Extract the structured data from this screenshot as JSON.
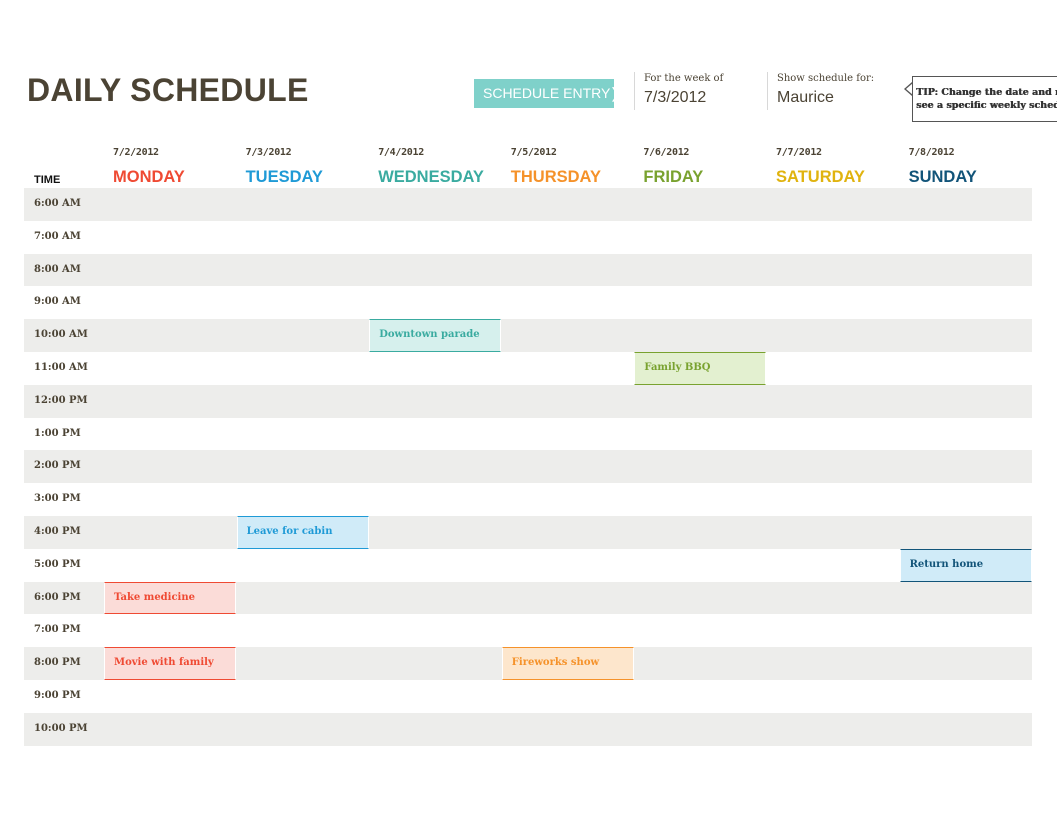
{
  "header": {
    "title": "DAILY SCHEDULE",
    "schedule_entry_button": "SCHEDULE ENTRY",
    "schedule_entry_arrow": "❯",
    "week_label": "For the week of",
    "week_value": "7/3/2012",
    "show_for_label": "Show schedule for:",
    "show_for_value": "Maurice",
    "tip_line1": "TIP: Change the date and name to",
    "tip_line2": "see a specific weekly schedule"
  },
  "grid": {
    "time_header": "TIME",
    "days": [
      {
        "date": "7/2/2012",
        "name": "MONDAY",
        "color": "#ef4a33"
      },
      {
        "date": "7/3/2012",
        "name": "TUESDAY",
        "color": "#1f9ad6"
      },
      {
        "date": "7/4/2012",
        "name": "WEDNESDAY",
        "color": "#3aaba0"
      },
      {
        "date": "7/5/2012",
        "name": "THURSDAY",
        "color": "#f5922a"
      },
      {
        "date": "7/6/2012",
        "name": "FRIDAY",
        "color": "#79a22f"
      },
      {
        "date": "7/7/2012",
        "name": "SATURDAY",
        "color": "#e0b30f"
      },
      {
        "date": "7/8/2012",
        "name": "SUNDAY",
        "color": "#125479"
      }
    ],
    "times": [
      "6:00 AM",
      "7:00 AM",
      "8:00 AM",
      "9:00 AM",
      "10:00 AM",
      "11:00 AM",
      "12:00 PM",
      "1:00 PM",
      "2:00 PM",
      "3:00 PM",
      "4:00 PM",
      "5:00 PM",
      "6:00 PM",
      "7:00 PM",
      "8:00 PM",
      "9:00 PM",
      "10:00 PM"
    ],
    "events": [
      {
        "label": "Downtown parade",
        "day": 2,
        "time": "10:00 AM",
        "color": "#3aaba0",
        "bg": "#d6f0ed"
      },
      {
        "label": "Family BBQ",
        "day": 4,
        "time": "11:00 AM",
        "color": "#79a22f",
        "bg": "#e3f0d0"
      },
      {
        "label": "Leave for cabin",
        "day": 1,
        "time": "4:00 PM",
        "color": "#1f9ad6",
        "bg": "#d0ebf8"
      },
      {
        "label": "Return home",
        "day": 6,
        "time": "5:00 PM",
        "color": "#125479",
        "bg": "#d0ebf8"
      },
      {
        "label": "Take medicine",
        "day": 0,
        "time": "6:00 PM",
        "color": "#ef4a33",
        "bg": "#fbdcd8"
      },
      {
        "label": "Movie with family",
        "day": 0,
        "time": "8:00 PM",
        "color": "#ef4a33",
        "bg": "#fbdcd8"
      },
      {
        "label": "Fireworks show",
        "day": 3,
        "time": "8:00 PM",
        "color": "#f5922a",
        "bg": "#fde6cc"
      }
    ]
  }
}
